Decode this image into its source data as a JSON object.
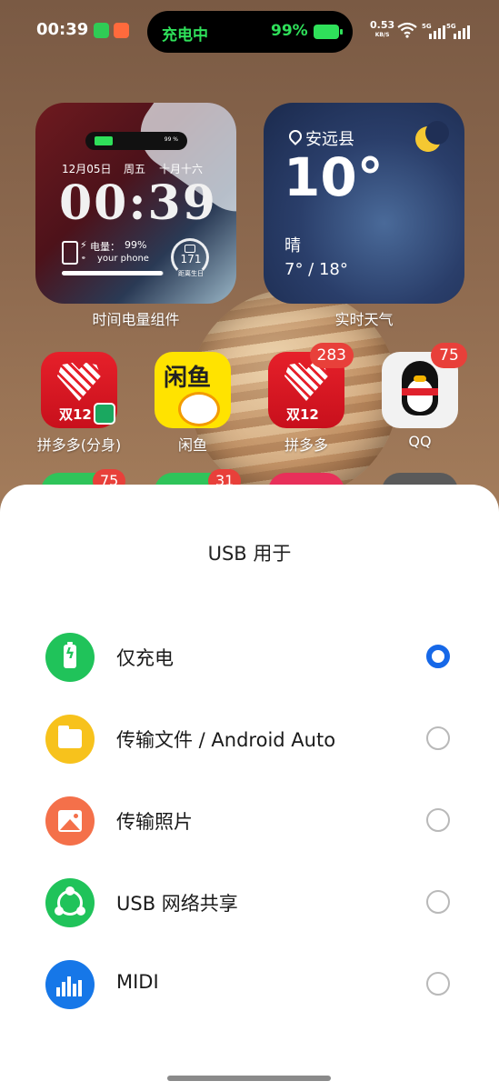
{
  "status_bar": {
    "time": "00:39",
    "charging_label": "充电中",
    "battery_percent": "99%",
    "net_speed_value": "0.53",
    "net_speed_unit": "KB/S",
    "sim1": "5G",
    "sim2": "5G",
    "battery_level": 0.99
  },
  "widgets": {
    "clock": {
      "mini_battery_pct": "99 %",
      "date": "12月05日",
      "weekday": "周五",
      "lunar": "十月十六",
      "time": "00:39",
      "charge_label": "电量：",
      "charge_pct": "99%",
      "your_phone": "your phone",
      "birthday_days": "171",
      "birthday_label": "距离生日",
      "label": "时间电量组件",
      "charge_level": 0.99
    },
    "weather": {
      "location": "安远县",
      "temperature": "10°",
      "condition": "晴",
      "range": "7° / 18°",
      "label": "实时天气"
    }
  },
  "apps": [
    {
      "label": "拼多多(分身)",
      "badge": ""
    },
    {
      "label": "闲鱼",
      "badge": "",
      "icon_text": "闲鱼"
    },
    {
      "label": "拼多多",
      "badge": "283"
    },
    {
      "label": "QQ",
      "badge": "75"
    }
  ],
  "app_row2_badges": [
    "75",
    "31"
  ],
  "pdd_icon_text": "双12",
  "usb_sheet": {
    "title": "USB 用于",
    "options": [
      {
        "label": "仅充电",
        "icon": "charging-battery-icon",
        "color": "#20c35a",
        "selected": true
      },
      {
        "label": "传输文件 / Android Auto",
        "icon": "folder-icon",
        "color": "#f7c21c",
        "selected": false
      },
      {
        "label": "传输照片",
        "icon": "photo-icon",
        "color": "#f4704a",
        "selected": false
      },
      {
        "label": "USB 网络共享",
        "icon": "share-network-icon",
        "color": "#20c35a",
        "selected": false
      },
      {
        "label": "MIDI",
        "icon": "midi-equalizer-icon",
        "color": "#1677e8",
        "selected": false
      }
    ]
  }
}
